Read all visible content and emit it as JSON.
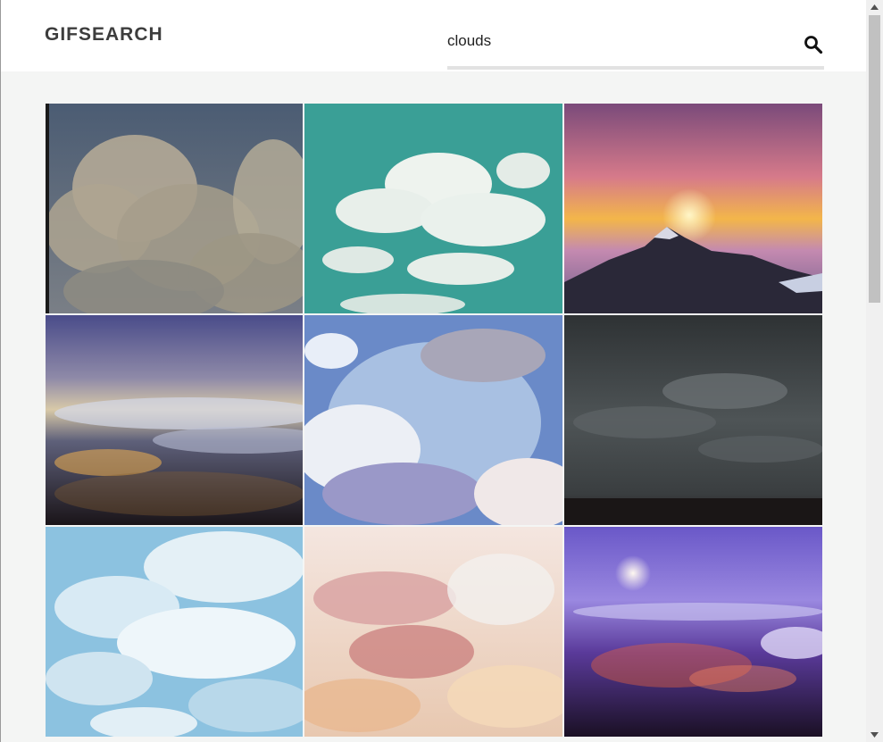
{
  "header": {
    "logo_text": "GIFSEARCH"
  },
  "search": {
    "value": "clouds",
    "icon": "search-icon"
  },
  "results": {
    "tiles": [
      {
        "name": "gif-cloudy-cumulus-vintage"
      },
      {
        "name": "gif-clouds-teal-sky"
      },
      {
        "name": "gif-sunset-mountain"
      },
      {
        "name": "gif-city-lights-fog"
      },
      {
        "name": "gif-anime-clouds-blue"
      },
      {
        "name": "gif-storm-clouds-dark"
      },
      {
        "name": "gif-fluffy-clouds-light-blue"
      },
      {
        "name": "gif-pink-clouds"
      },
      {
        "name": "gif-purple-night-city-moon"
      }
    ]
  },
  "colors": {
    "page_background": "#f4f5f4",
    "header_background": "#ffffff",
    "logo_color": "#3d3d3d"
  }
}
